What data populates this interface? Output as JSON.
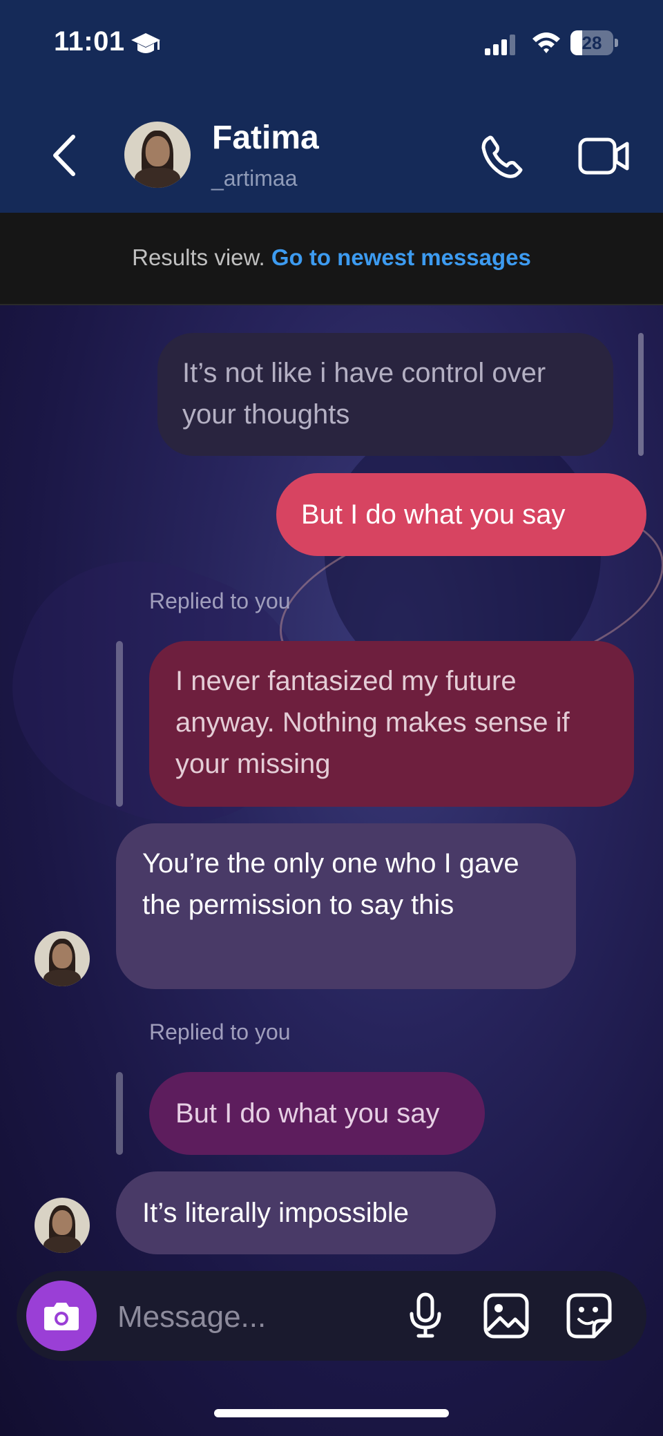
{
  "status_bar": {
    "time": "11:01",
    "battery": "28",
    "battery_level": 0.28,
    "icons": [
      "graduation-cap-icon",
      "cellular-signal-icon",
      "wifi-icon",
      "battery-icon"
    ]
  },
  "header": {
    "contact_name": "Fatima",
    "contact_username": "_artimaa",
    "icons": [
      "back-chevron-icon",
      "phone-call-icon",
      "video-call-icon"
    ]
  },
  "results_bar": {
    "label": "Results view.",
    "link": "Go to newest messages",
    "link_color": "#3d9bf0"
  },
  "messages": [
    {
      "sender": "me",
      "text": "It’s not like i have control over your thoughts"
    },
    {
      "sender": "me",
      "text": "But I do what you say"
    },
    {
      "sender": "them",
      "reply_label": "Replied to you",
      "quoted_text": "I never fantasized my future anyway. Nothing makes sense if your missing",
      "text": "You’re the only one who I gave the permission to say this"
    },
    {
      "sender": "them",
      "reply_label": "Replied to you",
      "quoted_text": "But I do what you say",
      "text": "It’s literally impossible"
    }
  ],
  "composer": {
    "placeholder": "Message...",
    "icons": [
      "camera-icon",
      "microphone-icon",
      "gallery-icon",
      "sticker-icon"
    ],
    "camera_color": "#9a3fd6"
  },
  "colors": {
    "header_bg": "#152a58",
    "sent_bubble": "#d74461",
    "received_bubble": "#493a67"
  }
}
